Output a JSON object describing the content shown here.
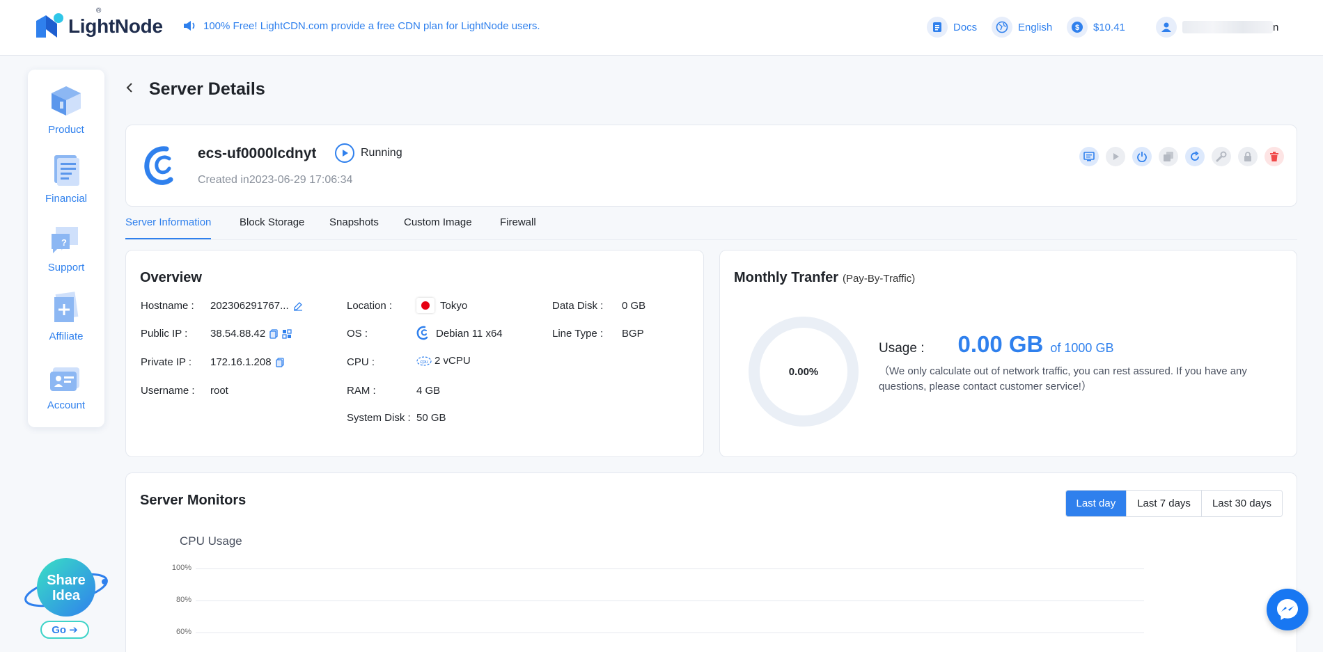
{
  "header": {
    "brand": "LightNode",
    "brand_reg": "®",
    "announcement": "100% Free! LightCDN.com provide a free CDN plan for LightNode users.",
    "docs": "Docs",
    "language": "English",
    "balance": "$10.41",
    "username_visible_end": "n"
  },
  "sidebar": {
    "items": [
      {
        "label": "Product",
        "icon": "product-icon"
      },
      {
        "label": "Financial",
        "icon": "financial-icon"
      },
      {
        "label": "Support",
        "icon": "support-icon"
      },
      {
        "label": "Affiliate",
        "icon": "affiliate-icon"
      },
      {
        "label": "Account",
        "icon": "account-icon"
      }
    ],
    "share_line1": "Share",
    "share_line2": "Idea",
    "go_label": "Go ➔"
  },
  "page": {
    "title": "Server Details"
  },
  "server": {
    "name": "ecs-uf0000lcdnyt",
    "status": "Running",
    "created": "Created in2023-06-29 17:06:34",
    "actions": [
      "console-icon",
      "start-icon",
      "power-icon",
      "reinstall-icon",
      "restart-icon",
      "wrench-icon",
      "lock-icon",
      "delete-icon"
    ]
  },
  "tabs": [
    "Server Information",
    "Block Storage",
    "Snapshots",
    "Custom Image",
    "Firewall"
  ],
  "overview": {
    "title": "Overview",
    "col1": [
      {
        "k": "Hostname :",
        "v": "202306291767..."
      },
      {
        "k": "Public IP :",
        "v": "38.54.88.42"
      },
      {
        "k": "Private IP :",
        "v": "172.16.1.208"
      },
      {
        "k": "Username :",
        "v": "root"
      }
    ],
    "col2": [
      {
        "k": "Location :",
        "v": "Tokyo"
      },
      {
        "k": "OS :",
        "v": "Debian 11 x64"
      },
      {
        "k": "CPU :",
        "v": "2 vCPU"
      },
      {
        "k": "RAM :",
        "v": "4 GB"
      },
      {
        "k": "System Disk :",
        "v": "50 GB"
      }
    ],
    "col3": [
      {
        "k": "Data Disk :",
        "v": "0 GB"
      },
      {
        "k": "Line Type :",
        "v": "BGP"
      }
    ]
  },
  "monthly": {
    "title": "Monthly Tranfer",
    "subtitle": "(Pay-By-Traffic)",
    "percent_label": "0.00%",
    "usage_label": "Usage :",
    "usage_value": "0.00 GB",
    "usage_of": "of 1000 GB",
    "note": "（We only calculate out of network traffic, you can rest assured. If you have any questions, please contact customer service!）"
  },
  "monitors": {
    "title": "Server Monitors",
    "ranges": [
      "Last day",
      "Last 7 days",
      "Last 30 days"
    ],
    "selected_range": "Last day",
    "chart_title": "CPU Usage",
    "y_ticks": [
      "100%",
      "80%",
      "60%"
    ]
  },
  "colors": {
    "accent": "#2f80ed",
    "danger": "#f04848"
  }
}
